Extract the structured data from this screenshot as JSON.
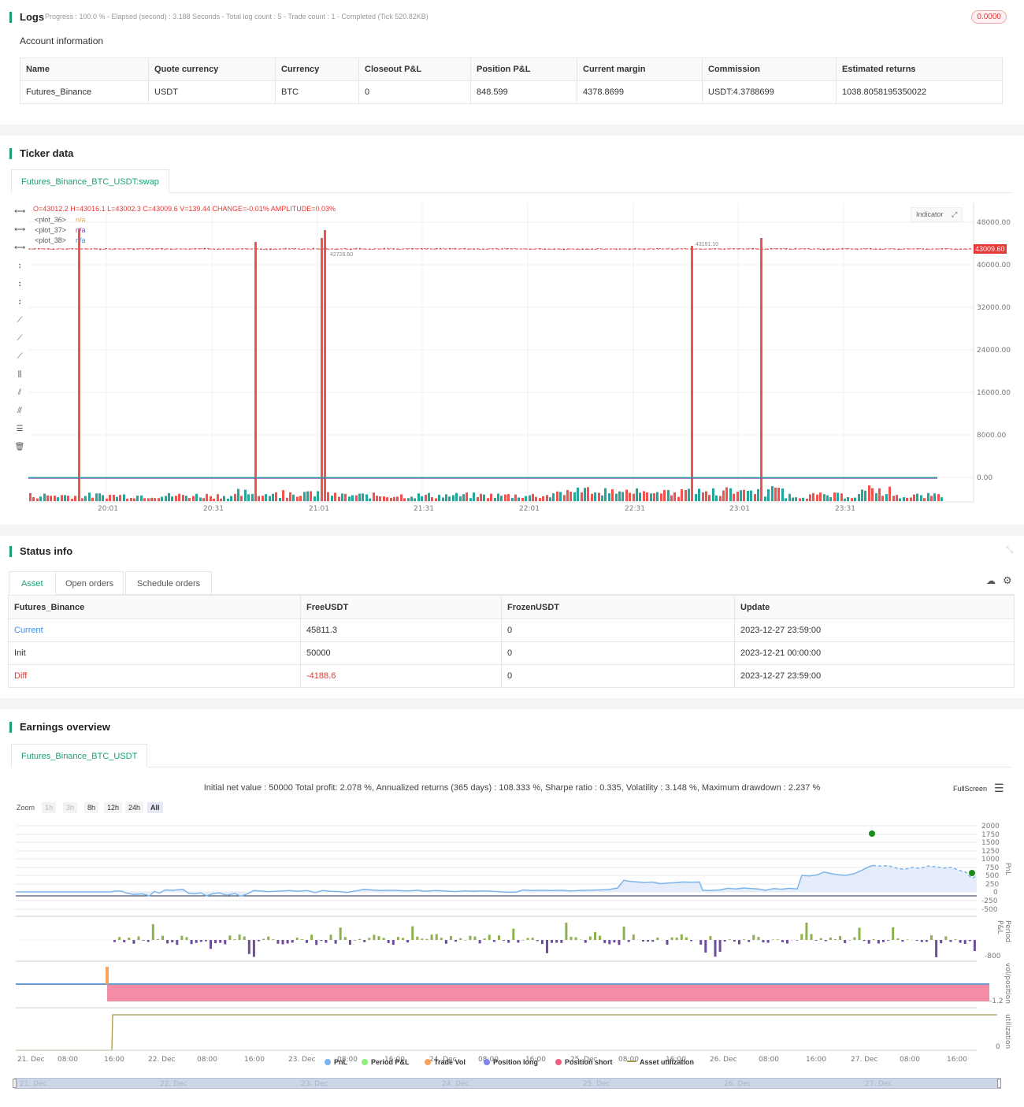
{
  "logs": {
    "title": "Logs",
    "meta": "Progress : 100.0 % - Elapsed (second) : 3.188  Seconds - Total log count : 5 - Trade count : 1 - Completed (Tick 520.82KB)",
    "badge": "0.0000",
    "subtitle": "Account information",
    "headers": [
      "Name",
      "Quote currency",
      "Currency",
      "Closeout P&L",
      "Position P&L",
      "Current margin",
      "Commission",
      "Estimated returns"
    ],
    "row": [
      "Futures_Binance",
      "USDT",
      "BTC",
      "0",
      "848.599",
      "4378.8699",
      "USDT:4.3788699",
      "1038.8058195350022"
    ]
  },
  "ticker": {
    "title": "Ticker data",
    "tab": "Futures_Binance_BTC_USDT:swap",
    "ohlc": "O=43012.2 H=43016.1 L=43002.3 C=43009.6 V=139.44 CHANGE=-0.01% AMPLITUDE=0.03%",
    "plots": [
      {
        "name": "<plot_36>",
        "val": "n/a"
      },
      {
        "name": "<plot_37>",
        "val": "n/a"
      },
      {
        "name": "<plot_38>",
        "val": "n/a"
      }
    ],
    "indicator_btn": "Indicator",
    "price_tag": "43009.60",
    "hi_label": "43191.10",
    "lo_label": "42726.60",
    "y_ticks": [
      "48000.00",
      "40000.00",
      "32000.00",
      "24000.00",
      "16000.00",
      "8000.00",
      "0.00"
    ],
    "x_ticks": [
      "20:01",
      "20:31",
      "21:01",
      "21:31",
      "22:01",
      "22:31",
      "23:01",
      "23:31"
    ]
  },
  "status": {
    "title": "Status info",
    "tabs": [
      "Asset",
      "Open orders",
      "Schedule orders"
    ],
    "headers": [
      "Futures_Binance",
      "FreeUSDT",
      "FrozenUSDT",
      "Update"
    ],
    "rows": [
      [
        "Current",
        "45811.3",
        "0",
        "2023-12-27 23:59:00"
      ],
      [
        "Init",
        "50000",
        "0",
        "2023-12-21 00:00:00"
      ],
      [
        "Diff",
        "-4188.6",
        "0",
        "2023-12-27 23:59:00"
      ]
    ],
    "colors": {
      "current": "#3b8fe6",
      "diff": "#e53935"
    }
  },
  "earnings": {
    "title": "Earnings overview",
    "tab": "Futures_Binance_BTC_USDT",
    "summary": "Initial net value : 50000 Total profit: 2.078 %, Annualized returns (365 days) : 108.333 %, Sharpe ratio : 0.335, Volatility : 3.148 %, Maximum drawdown : 2.237 %",
    "fullscreen": "FullScreen",
    "zoom_label": "Zoom",
    "zoom": [
      "1h",
      "3h",
      "8h",
      "12h",
      "24h",
      "All"
    ],
    "pnl_ticks": [
      "2000",
      "1750",
      "1500",
      "1250",
      "1000",
      "750",
      "500",
      "250",
      "0",
      "-250",
      "-500"
    ],
    "axis_titles": [
      "PnL",
      "Period P&L",
      "vol/position",
      "utilization"
    ],
    "period_tick": "-800",
    "pos_tick": "-1.2",
    "util_tick": "0",
    "x_ticks": [
      "21. Dec",
      "08:00",
      "16:00",
      "22. Dec",
      "08:00",
      "16:00",
      "23. Dec",
      "08:00",
      "16:00",
      "24. Dec",
      "08:00",
      "16:00",
      "25. Dec",
      "08:00",
      "16:00",
      "26. Dec",
      "08:00",
      "16:00",
      "27. Dec",
      "08:00",
      "16:00"
    ],
    "nav_ticks": [
      "21. Dec",
      "22. Dec",
      "23. Dec",
      "24. Dec",
      "25. Dec",
      "26. Dec",
      "27. Dec"
    ],
    "legend": [
      {
        "label": "PnL",
        "color": "#7cb5ec"
      },
      {
        "label": "Period P&L",
        "color": "#90ed7d"
      },
      {
        "label": "Trade Vol",
        "color": "#f7a35c"
      },
      {
        "label": "Position long",
        "color": "#8085e9"
      },
      {
        "label": "Position short",
        "color": "#f15c80"
      },
      {
        "label": "Asset utilization",
        "color": "#a59a4a"
      }
    ]
  }
}
